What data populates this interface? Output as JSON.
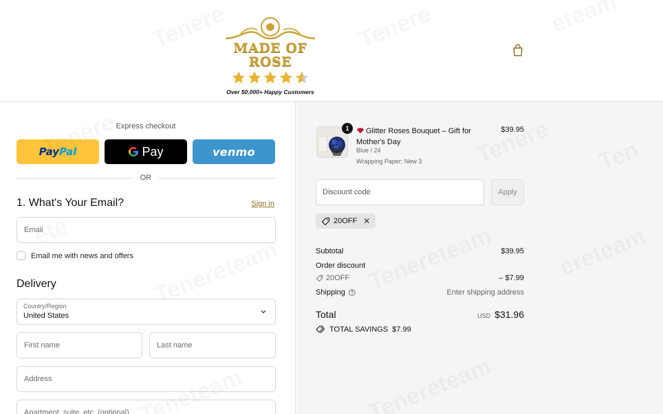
{
  "header": {
    "brand": "MADE OF ROSE",
    "rating_stars": 4.5,
    "tagline": "Over 50,000+ Happy Customers"
  },
  "express": {
    "title": "Express checkout",
    "paypal_a": "Pay",
    "paypal_b": "Pal",
    "gpay_label": "Pay",
    "venmo_label": "venmo",
    "or_label": "OR"
  },
  "contact": {
    "heading": "1. What's Your Email?",
    "signin": "Sign in",
    "email_placeholder": "Email",
    "newsletter_label": "Email me with news and offers"
  },
  "delivery": {
    "heading": "Delivery",
    "country_label": "Country/Region",
    "country_value": "United States",
    "first_name_placeholder": "First name",
    "last_name_placeholder": "Last name",
    "address_placeholder": "Address",
    "apartment_placeholder": "Apartment, suite, etc. (optional)"
  },
  "order": {
    "item": {
      "quantity": "1",
      "name": "Glitter Roses Bouquet – Gift for Mother's Day",
      "variant": "Blue / 24",
      "wrapping": "Wrapping Paper: New 3",
      "price": "$39.95"
    },
    "discount_placeholder": "Discount code",
    "apply_label": "Apply",
    "applied_code": "20OFF",
    "subtotal_label": "Subtotal",
    "subtotal_value": "$39.95",
    "order_discount_label": "Order discount",
    "order_discount_code": "20OFF",
    "order_discount_value": "– $7.99",
    "shipping_label": "Shipping",
    "shipping_value": "Enter shipping address",
    "total_label": "Total",
    "total_currency": "USD",
    "total_value": "$31.96",
    "savings_label": "TOTAL SAVINGS",
    "savings_value": "$7.99"
  },
  "colors": {
    "brand_gold": "#c9a23a",
    "paypal_yellow": "#ffc439",
    "venmo_blue": "#3d95ce",
    "signin_link": "#8a6d1e"
  }
}
